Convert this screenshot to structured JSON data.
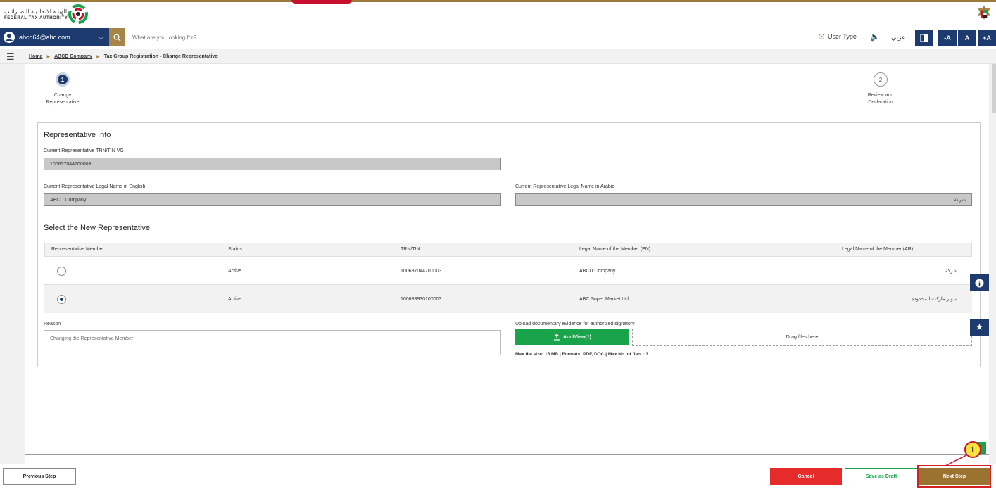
{
  "header": {
    "org_name_ar": "الهيئـة الاتحاديـة للـضـرائـب",
    "org_name_en": "FEDERAL TAX AUTHORITY",
    "user_email": "abcd64@abc.com",
    "search_placeholder": "What are you looking for?",
    "user_type_label": "User Type",
    "language_label": "عربي",
    "font_decrease": "-A",
    "font_normal": "A",
    "font_increase": "+A"
  },
  "breadcrumb": {
    "home": "Home",
    "company": "ABCD Company",
    "current": "Tax Group Registration - Change Representative"
  },
  "stepper": {
    "steps": [
      {
        "number": "1",
        "label_line1": "Change",
        "label_line2": "Representative",
        "state": "active"
      },
      {
        "number": "2",
        "label_line1": "Review and",
        "label_line2": "Declaration",
        "state": "pending"
      }
    ]
  },
  "representative_info": {
    "title": "Representative Info",
    "trn_label": "Current Representative TRN/TIN VG",
    "trn_value": "100637044700003",
    "legal_name_en_label": "Current Representative Legal Name in English",
    "legal_name_en_value": "ABCD Company",
    "legal_name_ar_label": "Current Representative Legal Name in Arabic",
    "legal_name_ar_value": "شركة"
  },
  "new_representative": {
    "title": "Select the New Representative",
    "columns": [
      "Representative Member",
      "Status",
      "TRN/TIN",
      "Legal Name of the Member (EN)",
      "Legal Name of the Member (AR)"
    ],
    "rows": [
      {
        "selected": false,
        "status": "Active",
        "trn": "100637044700003",
        "name_en": "ABCD Company",
        "name_ar": "شركة"
      },
      {
        "selected": true,
        "status": "Active",
        "trn": "100633930100003",
        "name_en": "ABC Super Market Ltd",
        "name_ar": "سوبر ماركت المحدودة"
      }
    ]
  },
  "reason": {
    "label": "Reason",
    "value": "Changing the Representative Member"
  },
  "upload": {
    "label": "Upload documentary evidence for authorized signatory",
    "button_label": "Add/View(1)",
    "dropzone_text": "Drag files here",
    "file_info": "Max file size: 15 MB  |  Formats: PDF, DOC  |  Max No. of files : 3"
  },
  "footer": {
    "previous_label": "Previous Step",
    "cancel_label": "Cancel",
    "save_draft_label": "Save as Draft",
    "next_label": "Next Step"
  },
  "annotation": {
    "callout_number": "1"
  },
  "colors": {
    "navy": "#1d3b6e",
    "gold": "#a78448",
    "green": "#19a34a",
    "red": "#e62b2b",
    "next_brown": "#9b7331"
  }
}
